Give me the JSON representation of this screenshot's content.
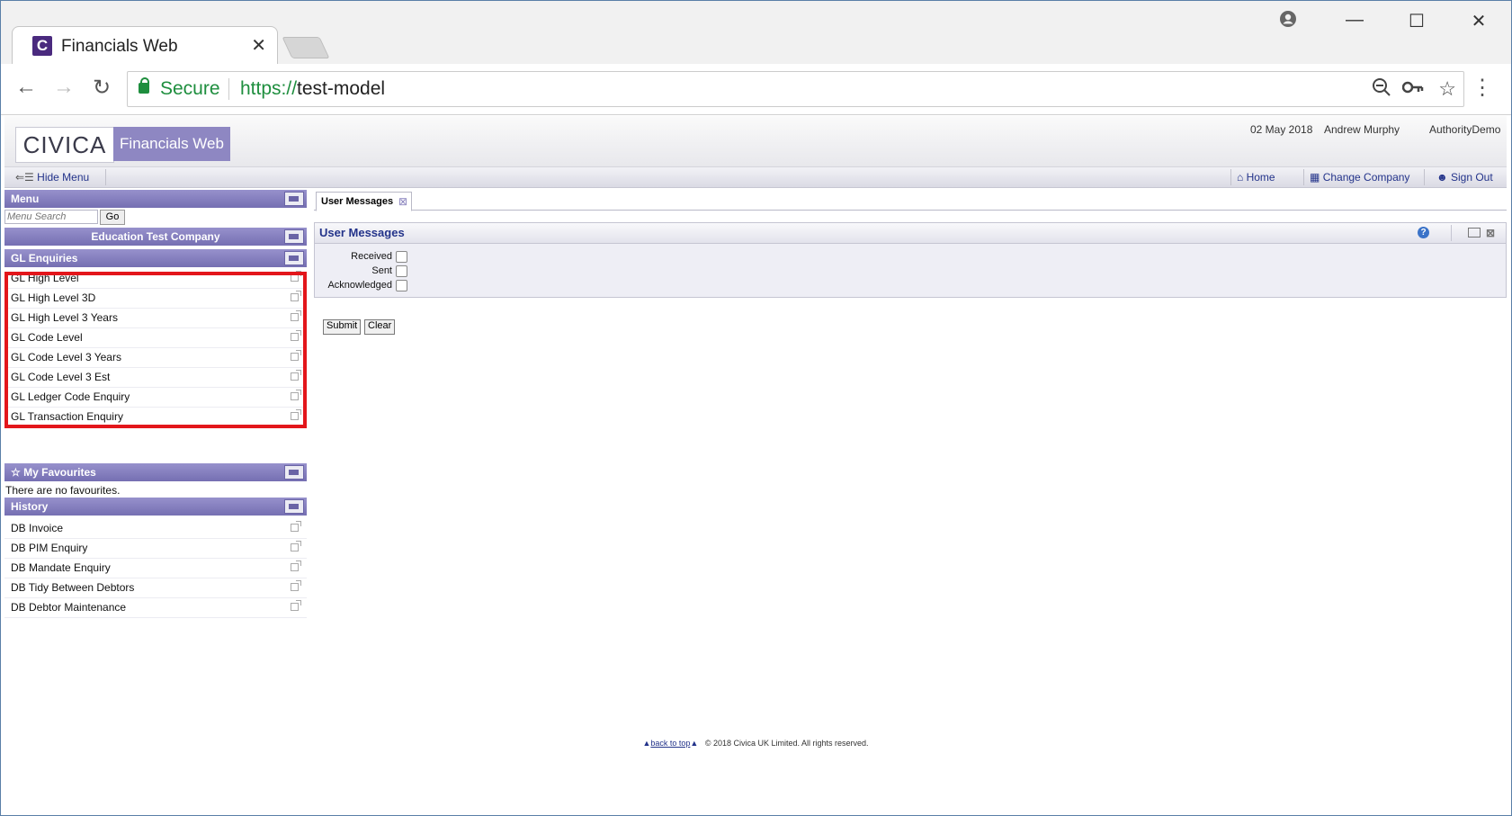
{
  "browser": {
    "tab_title": "Financials Web",
    "favicon_letter": "C",
    "secure_label": "Secure",
    "url_scheme": "https://",
    "url_host": "test-model"
  },
  "app": {
    "logo_text": "CIVICA",
    "product_title": "Financials Web",
    "date": "02 May 2018",
    "user": "Andrew Murphy",
    "authority": "AuthorityDemo",
    "hide_menu": "Hide Menu",
    "home": "Home",
    "change_company": "Change Company",
    "sign_out": "Sign Out",
    "accent_color": "#7f79bb"
  },
  "sidebar": {
    "menu_title": "Menu",
    "search_placeholder": "Menu Search",
    "go_label": "Go",
    "company": "Education Test Company",
    "section_title": "GL Enquiries",
    "items": [
      {
        "label": "GL High Level"
      },
      {
        "label": "GL High Level 3D"
      },
      {
        "label": "GL High Level 3 Years"
      },
      {
        "label": "GL Code Level"
      },
      {
        "label": "GL Code Level 3 Years"
      },
      {
        "label": "GL Code Level 3 Est"
      },
      {
        "label": "GL Ledger Code Enquiry"
      },
      {
        "label": "GL Transaction Enquiry"
      }
    ],
    "favourites_title": "My Favourites",
    "favourites_empty": "There are no favourites.",
    "history_title": "History",
    "history": [
      {
        "label": "DB Invoice"
      },
      {
        "label": "DB PIM Enquiry"
      },
      {
        "label": "DB Mandate Enquiry"
      },
      {
        "label": "DB Tidy Between Debtors"
      },
      {
        "label": "DB Debtor Maintenance"
      }
    ]
  },
  "main": {
    "tab_label": "User Messages",
    "panel_title": "User Messages",
    "filters": {
      "received": "Received",
      "sent": "Sent",
      "acknowledged": "Acknowledged"
    },
    "submit": "Submit",
    "clear": "Clear"
  },
  "footer": {
    "back_to_top": "back to top",
    "copyright": "© 2018 Civica UK Limited. All rights reserved."
  }
}
